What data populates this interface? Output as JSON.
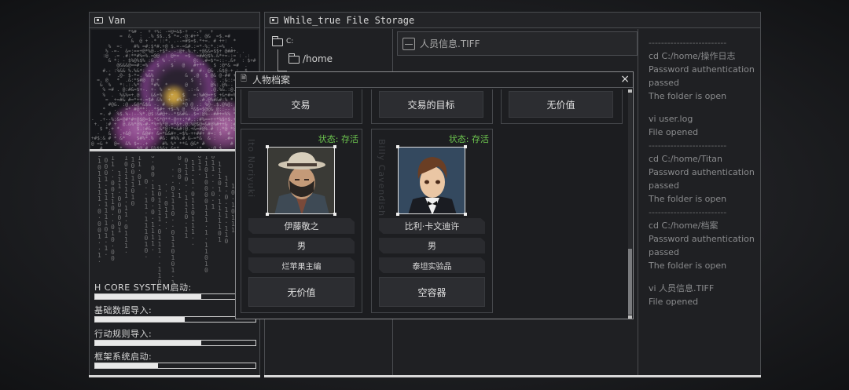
{
  "left_panel": {
    "title": "Van",
    "boot": [
      {
        "label": "H CORE SYSTEM启动:",
        "progress": 0.66
      },
      {
        "label": "基础数据导入:",
        "progress": 0.56
      },
      {
        "label": "行动规则导入:",
        "progress": 0.66
      },
      {
        "label": "框架系统启动:",
        "progress": 0.39
      }
    ]
  },
  "storage": {
    "title": "While_true File Storage",
    "tree": {
      "root": "C:",
      "child": "/home"
    },
    "file": "人员信息.TIFF",
    "log": [
      "-------------------------",
      "cd C:/home/操作日志",
      "Password authentication",
      "passed",
      "The folder is open",
      "",
      "vi user.log",
      "File opened",
      "-------------------------",
      "cd C:/home/Titan",
      "Password authentication",
      "passed",
      "The folder is open",
      "-------------------------",
      "cd C:/home/档案",
      "Password authentication",
      "passed",
      "The folder is open",
      "",
      "vi 人员信息.TIFF",
      "File opened"
    ]
  },
  "dialog": {
    "title": "人物档案",
    "close": "×",
    "top_row": [
      "交易",
      "交易的目标",
      "无价值"
    ],
    "cards": [
      {
        "name_vertical": "Ito Noriyuki",
        "status": "状态: 存活",
        "name": "伊藤敬之",
        "gender": "男",
        "role": "烂苹果主编",
        "value": "无价值"
      },
      {
        "name_vertical": "Billy Cavendish",
        "status": "状态: 存活",
        "name": "比利·卡文迪许",
        "gender": "男",
        "role": "泰坦实验品",
        "value": "空容器"
      }
    ]
  }
}
